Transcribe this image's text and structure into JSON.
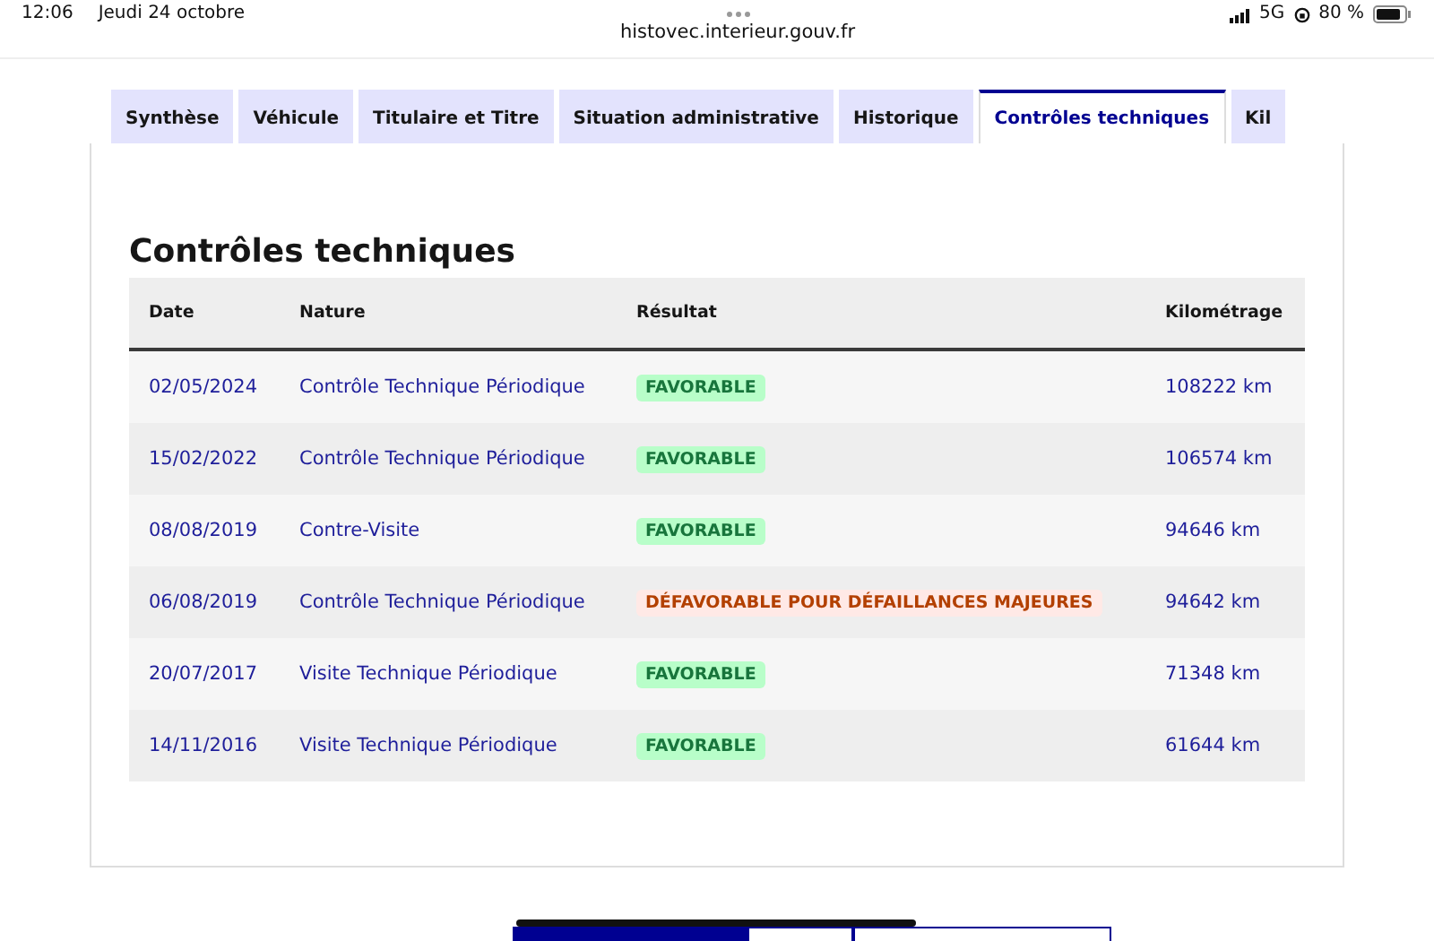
{
  "status_bar": {
    "time": "12:06",
    "date": "Jeudi 24 octobre",
    "url": "histovec.interieur.gouv.fr",
    "network": "5G",
    "battery": "80 %"
  },
  "tabs": [
    {
      "label": "Synthèse",
      "selected": false
    },
    {
      "label": "Véhicule",
      "selected": false
    },
    {
      "label": "Titulaire et Titre",
      "selected": false
    },
    {
      "label": "Situation administrative",
      "selected": false
    },
    {
      "label": "Historique",
      "selected": false
    },
    {
      "label": "Contrôles techniques",
      "selected": true
    },
    {
      "label": "Kil",
      "selected": false
    }
  ],
  "section": {
    "title": "Contrôles techniques"
  },
  "table": {
    "columns": [
      "Date",
      "Nature",
      "Résultat",
      "Kilométrage"
    ],
    "rows": [
      {
        "date": "02/05/2024",
        "nature": "Contrôle Technique Périodique",
        "result": {
          "label": "FAVORABLE",
          "kind": "favorable"
        },
        "km": "108222 km"
      },
      {
        "date": "15/02/2022",
        "nature": "Contrôle Technique Périodique",
        "result": {
          "label": "FAVORABLE",
          "kind": "favorable"
        },
        "km": "106574 km"
      },
      {
        "date": "08/08/2019",
        "nature": "Contre-Visite",
        "result": {
          "label": "FAVORABLE",
          "kind": "favorable"
        },
        "km": "94646 km"
      },
      {
        "date": "06/08/2019",
        "nature": "Contrôle Technique Périodique",
        "result": {
          "label": "DÉFAVORABLE POUR DÉFAILLANCES MAJEURES",
          "kind": "defavorable"
        },
        "km": "94642 km"
      },
      {
        "date": "20/07/2017",
        "nature": "Visite Technique Périodique",
        "result": {
          "label": "FAVORABLE",
          "kind": "favorable"
        },
        "km": "71348 km"
      },
      {
        "date": "14/11/2016",
        "nature": "Visite Technique Périodique",
        "result": {
          "label": "FAVORABLE",
          "kind": "favorable"
        },
        "km": "61644 km"
      }
    ]
  }
}
